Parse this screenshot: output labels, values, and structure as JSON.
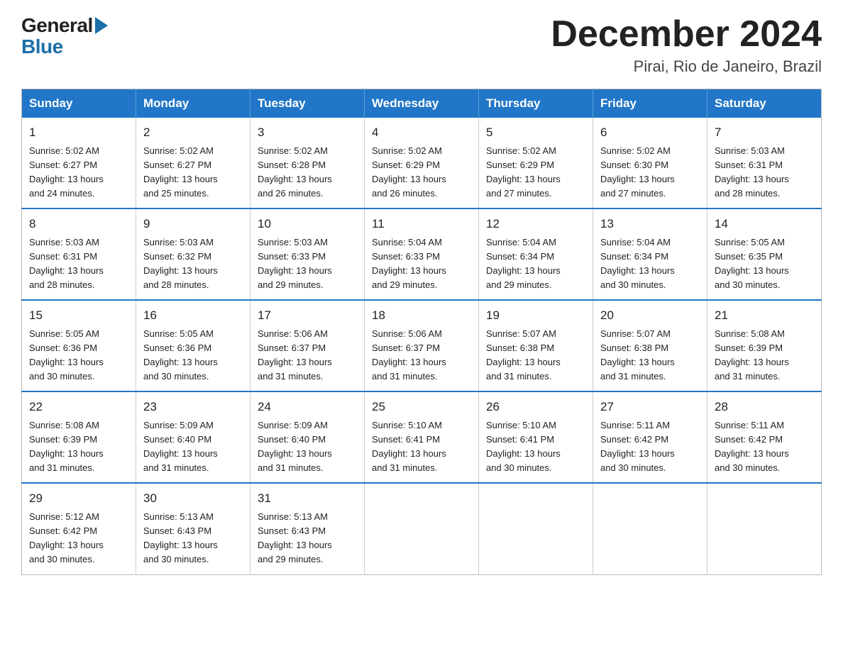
{
  "header": {
    "logo_general": "General",
    "logo_blue": "Blue",
    "title": "December 2024",
    "subtitle": "Pirai, Rio de Janeiro, Brazil"
  },
  "days_of_week": [
    "Sunday",
    "Monday",
    "Tuesday",
    "Wednesday",
    "Thursday",
    "Friday",
    "Saturday"
  ],
  "weeks": [
    [
      {
        "day": "1",
        "sunrise": "5:02 AM",
        "sunset": "6:27 PM",
        "daylight": "13 hours and 24 minutes."
      },
      {
        "day": "2",
        "sunrise": "5:02 AM",
        "sunset": "6:27 PM",
        "daylight": "13 hours and 25 minutes."
      },
      {
        "day": "3",
        "sunrise": "5:02 AM",
        "sunset": "6:28 PM",
        "daylight": "13 hours and 26 minutes."
      },
      {
        "day": "4",
        "sunrise": "5:02 AM",
        "sunset": "6:29 PM",
        "daylight": "13 hours and 26 minutes."
      },
      {
        "day": "5",
        "sunrise": "5:02 AM",
        "sunset": "6:29 PM",
        "daylight": "13 hours and 27 minutes."
      },
      {
        "day": "6",
        "sunrise": "5:02 AM",
        "sunset": "6:30 PM",
        "daylight": "13 hours and 27 minutes."
      },
      {
        "day": "7",
        "sunrise": "5:03 AM",
        "sunset": "6:31 PM",
        "daylight": "13 hours and 28 minutes."
      }
    ],
    [
      {
        "day": "8",
        "sunrise": "5:03 AM",
        "sunset": "6:31 PM",
        "daylight": "13 hours and 28 minutes."
      },
      {
        "day": "9",
        "sunrise": "5:03 AM",
        "sunset": "6:32 PM",
        "daylight": "13 hours and 28 minutes."
      },
      {
        "day": "10",
        "sunrise": "5:03 AM",
        "sunset": "6:33 PM",
        "daylight": "13 hours and 29 minutes."
      },
      {
        "day": "11",
        "sunrise": "5:04 AM",
        "sunset": "6:33 PM",
        "daylight": "13 hours and 29 minutes."
      },
      {
        "day": "12",
        "sunrise": "5:04 AM",
        "sunset": "6:34 PM",
        "daylight": "13 hours and 29 minutes."
      },
      {
        "day": "13",
        "sunrise": "5:04 AM",
        "sunset": "6:34 PM",
        "daylight": "13 hours and 30 minutes."
      },
      {
        "day": "14",
        "sunrise": "5:05 AM",
        "sunset": "6:35 PM",
        "daylight": "13 hours and 30 minutes."
      }
    ],
    [
      {
        "day": "15",
        "sunrise": "5:05 AM",
        "sunset": "6:36 PM",
        "daylight": "13 hours and 30 minutes."
      },
      {
        "day": "16",
        "sunrise": "5:05 AM",
        "sunset": "6:36 PM",
        "daylight": "13 hours and 30 minutes."
      },
      {
        "day": "17",
        "sunrise": "5:06 AM",
        "sunset": "6:37 PM",
        "daylight": "13 hours and 31 minutes."
      },
      {
        "day": "18",
        "sunrise": "5:06 AM",
        "sunset": "6:37 PM",
        "daylight": "13 hours and 31 minutes."
      },
      {
        "day": "19",
        "sunrise": "5:07 AM",
        "sunset": "6:38 PM",
        "daylight": "13 hours and 31 minutes."
      },
      {
        "day": "20",
        "sunrise": "5:07 AM",
        "sunset": "6:38 PM",
        "daylight": "13 hours and 31 minutes."
      },
      {
        "day": "21",
        "sunrise": "5:08 AM",
        "sunset": "6:39 PM",
        "daylight": "13 hours and 31 minutes."
      }
    ],
    [
      {
        "day": "22",
        "sunrise": "5:08 AM",
        "sunset": "6:39 PM",
        "daylight": "13 hours and 31 minutes."
      },
      {
        "day": "23",
        "sunrise": "5:09 AM",
        "sunset": "6:40 PM",
        "daylight": "13 hours and 31 minutes."
      },
      {
        "day": "24",
        "sunrise": "5:09 AM",
        "sunset": "6:40 PM",
        "daylight": "13 hours and 31 minutes."
      },
      {
        "day": "25",
        "sunrise": "5:10 AM",
        "sunset": "6:41 PM",
        "daylight": "13 hours and 31 minutes."
      },
      {
        "day": "26",
        "sunrise": "5:10 AM",
        "sunset": "6:41 PM",
        "daylight": "13 hours and 30 minutes."
      },
      {
        "day": "27",
        "sunrise": "5:11 AM",
        "sunset": "6:42 PM",
        "daylight": "13 hours and 30 minutes."
      },
      {
        "day": "28",
        "sunrise": "5:11 AM",
        "sunset": "6:42 PM",
        "daylight": "13 hours and 30 minutes."
      }
    ],
    [
      {
        "day": "29",
        "sunrise": "5:12 AM",
        "sunset": "6:42 PM",
        "daylight": "13 hours and 30 minutes."
      },
      {
        "day": "30",
        "sunrise": "5:13 AM",
        "sunset": "6:43 PM",
        "daylight": "13 hours and 30 minutes."
      },
      {
        "day": "31",
        "sunrise": "5:13 AM",
        "sunset": "6:43 PM",
        "daylight": "13 hours and 29 minutes."
      },
      null,
      null,
      null,
      null
    ]
  ],
  "labels": {
    "sunrise": "Sunrise:",
    "sunset": "Sunset:",
    "daylight": "Daylight:"
  }
}
